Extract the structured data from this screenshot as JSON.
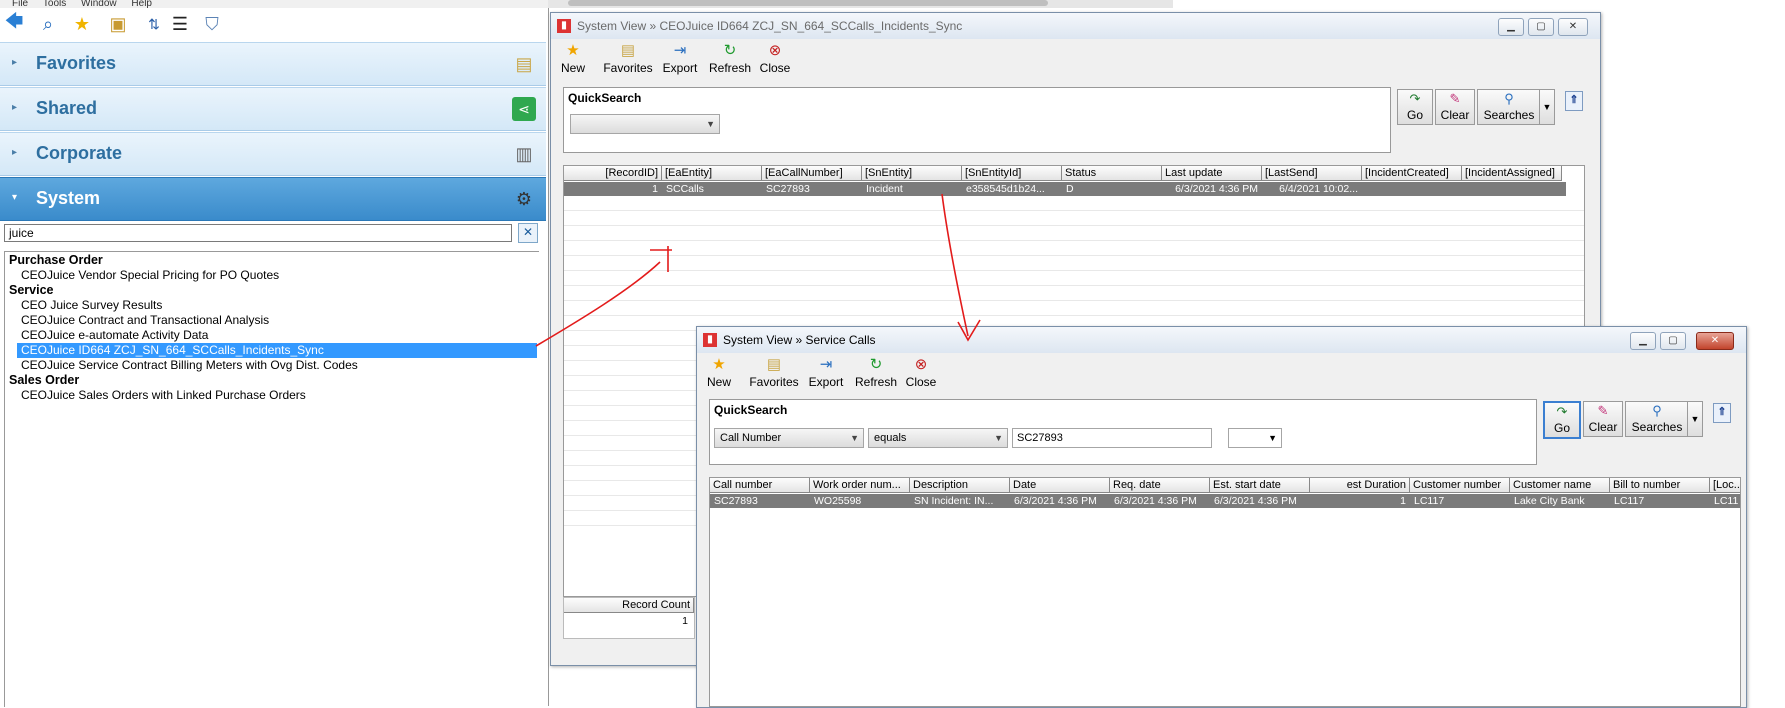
{
  "menubar": {
    "items": [
      "File",
      "Tools",
      "Window",
      "Help"
    ]
  },
  "accordion": [
    {
      "label": "Favorites",
      "icon": "favorites-folder-icon"
    },
    {
      "label": "Shared",
      "icon": "share-icon"
    },
    {
      "label": "Corporate",
      "icon": "building-icon"
    },
    {
      "label": "System",
      "icon": "gears-icon"
    }
  ],
  "search": {
    "value": "juice",
    "clear": "✕"
  },
  "tree": {
    "groups": [
      {
        "label": "Purchase Order",
        "items": [
          "CEOJuice Vendor Special Pricing for PO Quotes"
        ]
      },
      {
        "label": "Service",
        "items": [
          "CEO Juice Survey Results",
          "CEOJuice Contract and Transactional Analysis",
          "CEOJuice e-automate Activity Data",
          "CEOJuice ID664 ZCJ_SN_664_SCCalls_Incidents_Sync",
          "CEOJuice Service Contract Billing Meters with Ovg Dist. Codes"
        ]
      },
      {
        "label": "Sales Order",
        "items": [
          "CEOJuice Sales Orders with Linked Purchase Orders"
        ]
      }
    ],
    "selected": "CEOJuice ID664 ZCJ_SN_664_SCCalls_Incidents_Sync"
  },
  "window1": {
    "title": "System View » CEOJuice ID664 ZCJ_SN_664_SCCalls_Incidents_Sync",
    "toolbar": [
      "New",
      "Favorites",
      "Export",
      "Refresh",
      "Close"
    ],
    "quicksearch_label": "QuickSearch",
    "buttons": {
      "go": "Go",
      "clear": "Clear",
      "searches": "Searches"
    },
    "columns": [
      "[RecordID]",
      "[EaEntity]",
      "[EaCallNumber]",
      "[SnEntity]",
      "[SnEntityId]",
      "Status",
      "Last update",
      "[LastSend]",
      "[IncidentCreated]",
      "[IncidentAssigned]"
    ],
    "row": [
      "1",
      "SCCalls",
      "SC27893",
      "Incident",
      "e358545d1b24...",
      "D",
      "6/3/2021 4:36 PM",
      "6/4/2021 10:02...",
      "",
      ""
    ],
    "record_count_label": "Record Count",
    "record_count": "1"
  },
  "window2": {
    "title": "System View » Service Calls",
    "toolbar": [
      "New",
      "Favorites",
      "Export",
      "Refresh",
      "Close"
    ],
    "quicksearch_label": "QuickSearch",
    "field": "Call Number",
    "operator": "equals",
    "value": "SC27893",
    "buttons": {
      "go": "Go",
      "clear": "Clear",
      "searches": "Searches"
    },
    "columns": [
      "Call number",
      "Work order num...",
      "Description",
      "Date",
      "Req. date",
      "Est. start date",
      "est Duration",
      "Customer number",
      "Customer name",
      "Bill to number",
      "[Loc..."
    ],
    "row": [
      "SC27893",
      "WO25598",
      "SN Incident: IN...",
      "6/3/2021 4:36 PM",
      "6/3/2021 4:36 PM",
      "6/3/2021 4:36 PM",
      "1",
      "LC117",
      "Lake City Bank",
      "LC117",
      "LC11"
    ]
  }
}
